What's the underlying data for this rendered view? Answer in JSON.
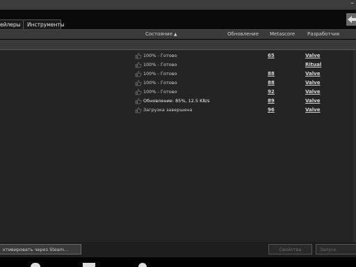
{
  "window": {
    "minimize_label": "–"
  },
  "tabs": [
    {
      "label": "ейлеры"
    },
    {
      "label": "Инструменты"
    }
  ],
  "columns": {
    "status": "Состояние",
    "sort_indicator": "▲",
    "update": "Обновление",
    "metascore": "Metascore",
    "developer": "Разработчик"
  },
  "rows": [
    {
      "status": "100% - Готово",
      "metascore": "65",
      "developer": "Valve",
      "active": false
    },
    {
      "status": "100% - Готово",
      "metascore": "",
      "developer": "Ritual",
      "active": false
    },
    {
      "status": "100% - Готово",
      "metascore": "88",
      "developer": "Valve",
      "active": false
    },
    {
      "status": "100% - Готово",
      "metascore": "88",
      "developer": "Valve",
      "active": false
    },
    {
      "status": "100% - Готово",
      "metascore": "92",
      "developer": "Valve",
      "active": false
    },
    {
      "status": "Обновление: 85%, 12.5 KB/s",
      "metascore": "89",
      "developer": "Valve",
      "active": true
    },
    {
      "status": "Загрузка завершена",
      "metascore": "96",
      "developer": "Valve",
      "active": false
    }
  ],
  "footer": {
    "activate_label": "ктивировать через Steam...",
    "properties_label": "Свойства",
    "launch_label": "Запуск"
  },
  "icons": {
    "row_icon": "thumbs-up-icon",
    "back": "back-arrow-icon"
  }
}
